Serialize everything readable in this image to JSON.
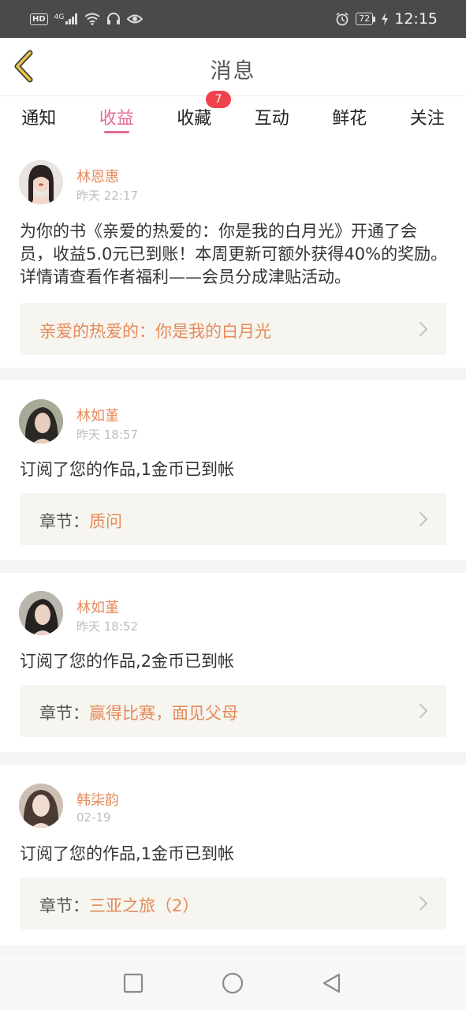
{
  "status_bar": {
    "left_icons": [
      "hd-icon",
      "4g-signal-icon",
      "wifi-icon",
      "headset-icon",
      "eye-icon"
    ],
    "network_label": "4G",
    "hd_label": "HD",
    "battery": "72",
    "time": "12:15"
  },
  "header": {
    "title": "消息"
  },
  "tabs": [
    {
      "label": "通知"
    },
    {
      "label": "收益",
      "active": true
    },
    {
      "label": "收藏",
      "badge": "7"
    },
    {
      "label": "互动"
    },
    {
      "label": "鲜花"
    },
    {
      "label": "关注"
    }
  ],
  "messages": [
    {
      "name": "林恩惠",
      "time": "昨天 22:17",
      "text": "为你的书《亲爱的热爱的：你是我的白月光》开通了会员，收益5.0元已到账！本周更新可额外获得40%的奖励。详情请查看作者福利——会员分成津贴活动。",
      "link_prefix": "",
      "link_title": "亲爱的热爱的：你是我的白月光"
    },
    {
      "name": "林如堇",
      "time": "昨天 18:57",
      "text": "订阅了您的作品,1金币已到帐",
      "link_prefix": "章节：",
      "link_title": "质问"
    },
    {
      "name": "林如堇",
      "time": "昨天 18:52",
      "text": "订阅了您的作品,2金币已到帐",
      "link_prefix": "章节：",
      "link_title": "赢得比赛，面见父母"
    },
    {
      "name": "韩柒韵",
      "time": "02-19",
      "text": "订阅了您的作品,1金币已到帐",
      "link_prefix": "章节：",
      "link_title": "三亚之旅（2）"
    }
  ],
  "colors": {
    "accent": "#e56a96",
    "name": "#e58a5a",
    "badge": "#f0424d",
    "link_bg": "#f6f5ef"
  }
}
